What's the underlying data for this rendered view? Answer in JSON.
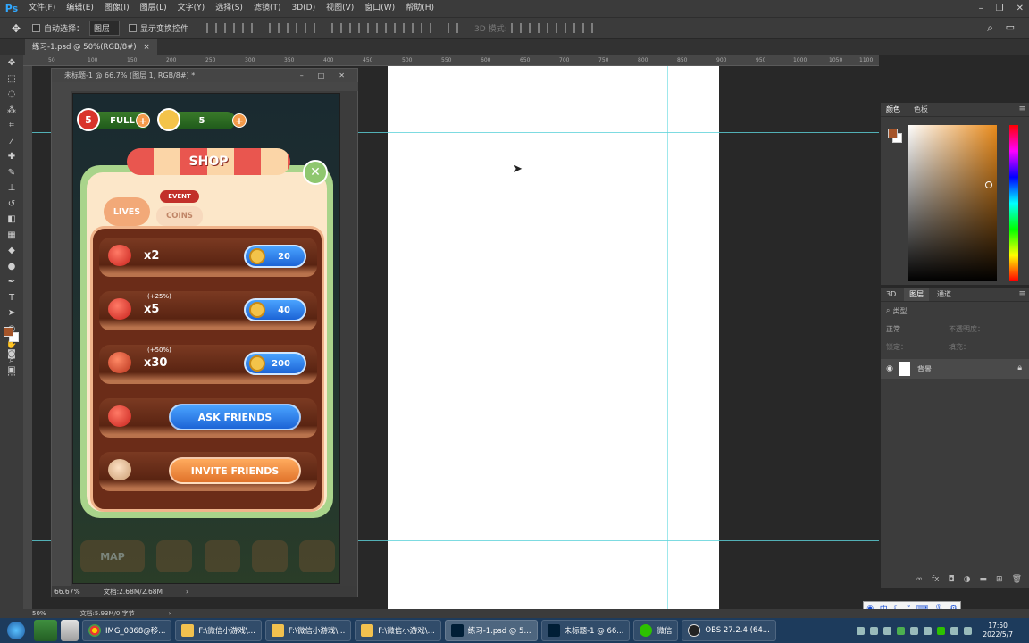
{
  "app": {
    "logo": "Ps"
  },
  "menu": [
    "文件(F)",
    "编辑(E)",
    "图像(I)",
    "图层(L)",
    "文字(Y)",
    "选择(S)",
    "滤镜(T)",
    "3D(D)",
    "视图(V)",
    "窗口(W)",
    "帮助(H)"
  ],
  "options": {
    "auto_select_label": "自动选择：",
    "auto_select_value": "图层",
    "show_transform_label": "显示变换控件"
  },
  "doc_tab": {
    "title": "练习-1.psd @ 50%(RGB/8#)",
    "close": "×"
  },
  "ruler_ticks": [
    "50",
    "100",
    "150",
    "200",
    "250",
    "300",
    "350",
    "400",
    "450",
    "500",
    "550",
    "600",
    "650",
    "700",
    "750",
    "800",
    "850",
    "900",
    "950",
    "1000",
    "1050",
    "1100"
  ],
  "float_window": {
    "title": "未标题-1 @ 66.7% (图层 1, RGB/8#) *",
    "zoom": "66.67%",
    "doc_size": "文档:2.68M/2.68M"
  },
  "game": {
    "lives_count": "5",
    "lives_status": "FULL",
    "coins_count": "5",
    "shop_title": "SHOP",
    "tab_lives": "LIVES",
    "tab_coins": "COINS",
    "badge_event": "EVENT",
    "items": [
      {
        "qty": "x2",
        "bonus": "",
        "price": "20"
      },
      {
        "qty": "x5",
        "bonus": "(+25%)",
        "price": "40"
      },
      {
        "qty": "x30",
        "bonus": "(+50%)",
        "price": "200"
      }
    ],
    "ask_friends": "ASK FRIENDS",
    "invite_friends": "INVITE FRIENDS",
    "nav_map": "MAP"
  },
  "color_panel": {
    "tab_color": "颜色",
    "tab_swatches": "色板",
    "foreground": "#a5552a"
  },
  "layers_panel": {
    "tab_3d": "3D",
    "tab_layers": "图层",
    "tab_channels": "通道",
    "search_placeholder": "类型",
    "blend_mode": "正常",
    "opacity_label": "不透明度：",
    "lock_label": "锁定：",
    "fill_label": "填充：",
    "layer_name": "背景"
  },
  "statusbar": {
    "zoom": "50%",
    "doc_size": "文档:5.93M/0 字节"
  },
  "taskbar": {
    "tasks": [
      "IMG_0868@移...",
      "F:\\微信小游戏\\...",
      "F:\\微信小游戏\\...",
      "F:\\微信小游戏\\...",
      "练习-1.psd @ 5...",
      "未标题-1 @ 66...",
      "微信",
      "OBS 27.2.4 (64..."
    ],
    "time": "17:50",
    "date": "2022/5/7"
  },
  "ime": {
    "label": "中"
  }
}
